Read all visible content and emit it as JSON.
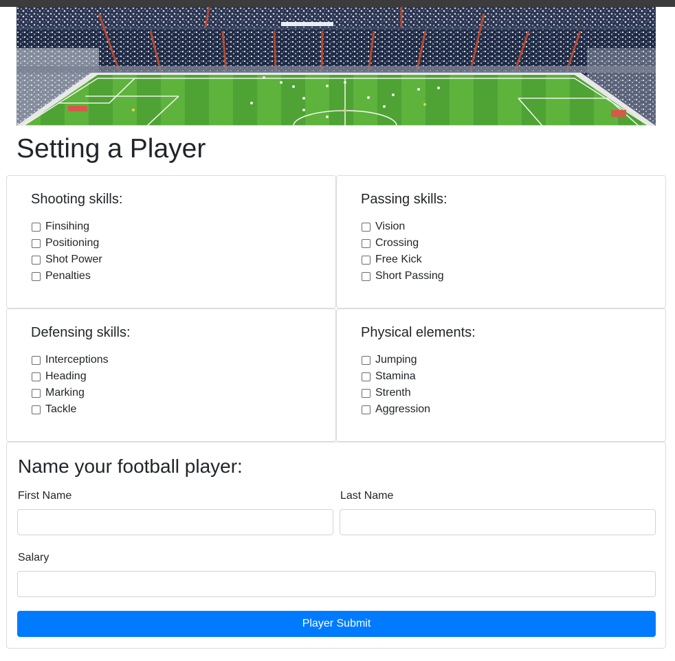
{
  "page": {
    "title": "Setting a Player"
  },
  "skills": {
    "shooting": {
      "title": "Shooting skills:",
      "items": [
        "Finsihing",
        "Positioning",
        "Shot Power",
        "Penalties"
      ]
    },
    "passing": {
      "title": "Passing skills:",
      "items": [
        "Vision",
        "Crossing",
        "Free Kick",
        "Short Passing"
      ]
    },
    "defensing": {
      "title": "Defensing skills:",
      "items": [
        "Interceptions",
        "Heading",
        "Marking",
        "Tackle"
      ]
    },
    "physical": {
      "title": "Physical elements:",
      "items": [
        "Jumping",
        "Stamina",
        "Strenth",
        "Aggression"
      ]
    }
  },
  "form": {
    "title": "Name your football player:",
    "first_name_label": "First Name",
    "first_name_value": "",
    "last_name_label": "Last Name",
    "last_name_value": "",
    "salary_label": "Salary",
    "salary_value": "",
    "submit_label": "Player Submit"
  },
  "colors": {
    "primary": "#007bff",
    "border": "#dcdcdc",
    "text": "#212529",
    "pitch": "#5aa83a"
  }
}
